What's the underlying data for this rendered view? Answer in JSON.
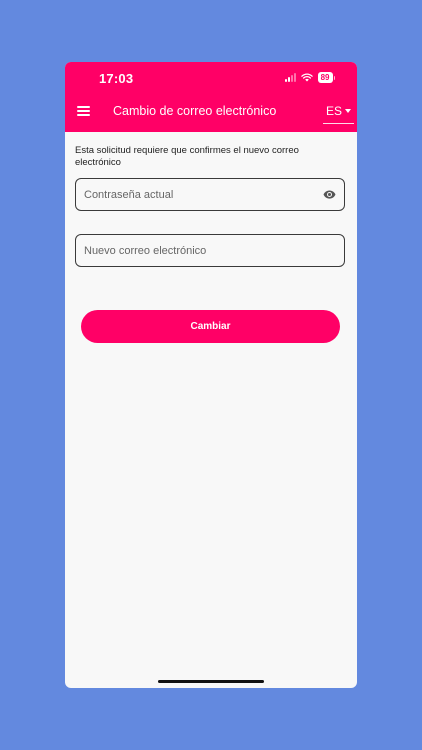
{
  "status_bar": {
    "time": "17:03",
    "battery": "89"
  },
  "app_bar": {
    "title": "Cambio de correo electrónico",
    "language": "ES"
  },
  "form": {
    "info_text": "Esta solicitud requiere que confirmes el nuevo correo electrónico",
    "password_placeholder": "Contraseña actual",
    "password_value": "",
    "email_placeholder": "Nuevo correo electrónico",
    "email_value": "",
    "submit_label": "Cambiar"
  },
  "icons": {
    "menu": "menu-icon",
    "password_toggle": "eye-icon",
    "language_dropdown": "caret-down-icon"
  },
  "colors": {
    "background": "#6389DF",
    "accent": "#FF0066",
    "surface": "#F8F8F8"
  }
}
